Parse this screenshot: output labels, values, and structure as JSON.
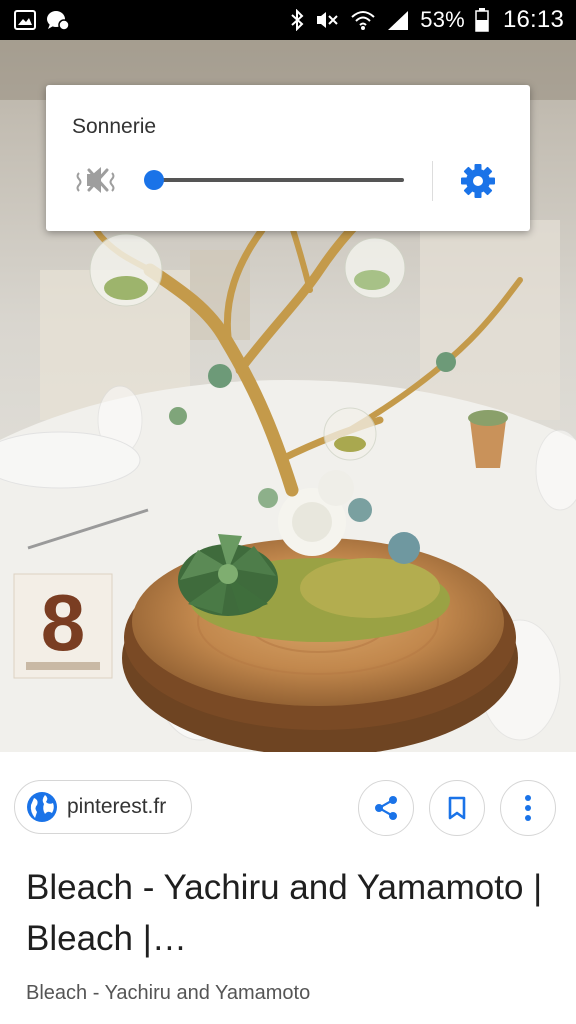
{
  "status_bar": {
    "left_icons": [
      "image-icon",
      "chat-bubble-icon"
    ],
    "right_icons": [
      "bluetooth-icon",
      "vibrate-mute-icon",
      "wifi-icon",
      "signal-icon"
    ],
    "battery": "53%",
    "time": "16:13"
  },
  "photo": {
    "table_number": "8"
  },
  "volume_panel": {
    "title": "Sonnerie",
    "mute_icon": "speaker-muted-icon",
    "level": 0.0,
    "settings_icon": "gear-icon",
    "accent_color": "#1a73e8"
  },
  "card": {
    "source": "pinterest.fr",
    "source_icon": "globe-icon",
    "actions": [
      "share-icon",
      "bookmark-icon",
      "more-vert-icon"
    ],
    "title": "Bleach - Yachiru and Yamamoto | Bleach |…",
    "subtitle": "Bleach - Yachiru and Yamamoto"
  }
}
